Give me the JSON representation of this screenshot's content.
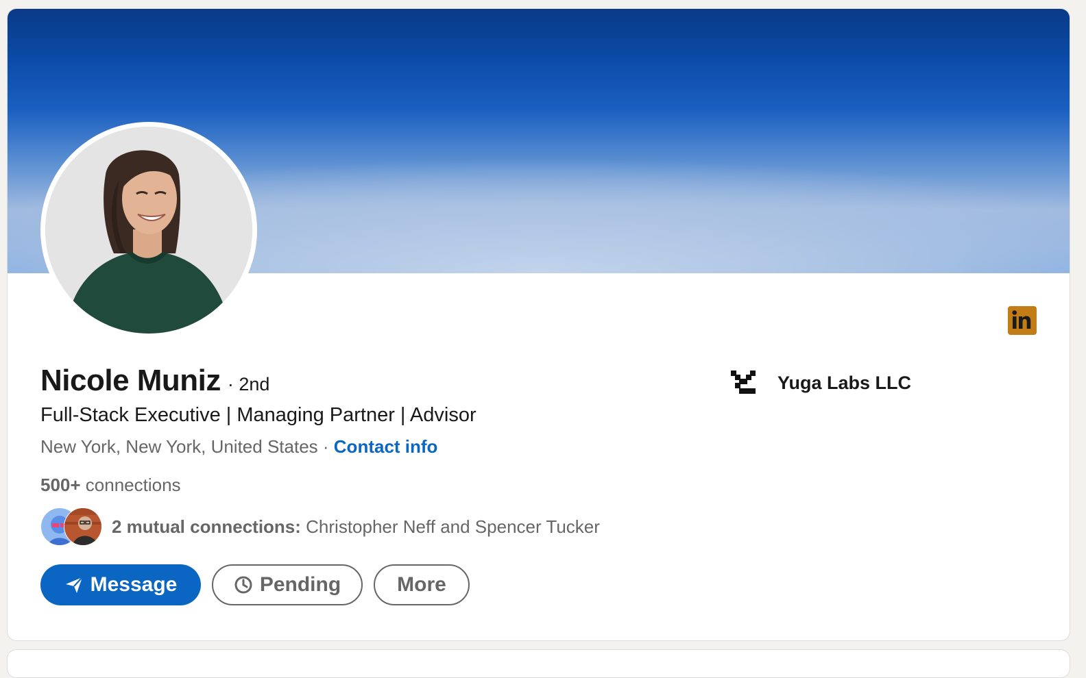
{
  "profile": {
    "name": "Nicole Muniz",
    "degree": "· 2nd",
    "headline": "Full-Stack Executive | Managing Partner | Advisor",
    "location": "New York, New York, United States",
    "location_separator": " · ",
    "contact_info": "Contact info",
    "connections_count": "500+",
    "connections_label": " connections",
    "mutual_label": "2 mutual connections:",
    "mutual_names": " Christopher Neff and Spencer Tucker"
  },
  "company": {
    "name": "Yuga Labs LLC",
    "logo_icon": "yuga-labs-logo"
  },
  "actions": {
    "message_label": "Message",
    "message_icon": "send-icon",
    "pending_label": "Pending",
    "pending_icon": "clock-icon",
    "more_label": "More"
  },
  "badge": {
    "icon": "linkedin-logo-icon",
    "color": "#c37d16"
  },
  "colors": {
    "accent": "#0a66c2",
    "text_primary": "#191919",
    "text_secondary": "#666666"
  }
}
